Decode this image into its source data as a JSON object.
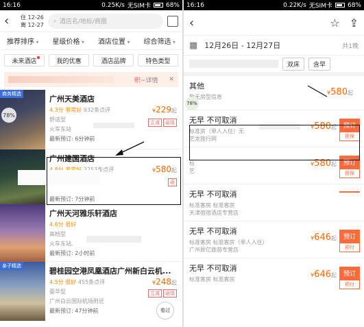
{
  "left": {
    "status": {
      "time": "16:16",
      "speed": "0.25K/s",
      "sim": "无SIM卡",
      "battery": "68%"
    },
    "dates": {
      "checkin": "住 12-26",
      "checkout": "离 12-27"
    },
    "search_placeholder": "酒店名/地标/商圈",
    "filters": [
      "推荐排序",
      "星级价格",
      "酒店位置",
      "综合筛选"
    ],
    "tags": [
      "未来酒店",
      "我的优惠",
      "酒店品牌",
      "特色类型"
    ],
    "promo": {
      "text": "积~",
      "detail": "详情",
      "close": "✕"
    },
    "hotels": [
      {
        "badge": "商务精选",
        "circle": "78%",
        "name": "广州天美酒店",
        "score": "4.3分",
        "level": "非常好",
        "reviews": "932条点评",
        "type": "舒适型",
        "loc": "火车东站",
        "recent": "最新预订: 6分钟前",
        "price": "229",
        "pills": [
          "立减",
          "返现"
        ]
      },
      {
        "name": "广州建国酒店",
        "score": "4.8分",
        "level": "非常好",
        "reviews": "2253条点评",
        "recent": "最新预订: 7分钟前",
        "price": "580",
        "pills": [
          "返"
        ]
      },
      {
        "name": "广州天河雅乐轩酒店",
        "score": "4.6分",
        "level": "很好",
        "type": "高档型",
        "loc": "火车东站,",
        "recent": "最新预订: 2小时前"
      },
      {
        "badge": "亲子精选",
        "name": "碧桂园空港凤凰酒店广州新白云机...",
        "score": "4.5分",
        "level": "很好",
        "reviews": "455条点评",
        "type": "豪华型",
        "loc": "广州白云国际机场附近",
        "recent": "最新预订: 47分钟前",
        "price": "248",
        "pills": [
          "立减",
          "返现"
        ],
        "kanguo": "看过"
      }
    ]
  },
  "right": {
    "status": {
      "time": "16:16",
      "speed": "0.22K/s",
      "sim": "无SIM卡",
      "battery": "68%"
    },
    "date_range": "12月26日 - 12月27日",
    "nights": "共1晚",
    "filter_tags": [
      "双床",
      "含早"
    ],
    "rooms": [
      {
        "title": "其他",
        "sub1": "暂无房型信息",
        "sub2": "",
        "price": "580",
        "circle": "78%"
      },
      {
        "title": "无早 不可取消",
        "sub1": "标准房（单人入住）无",
        "sub2": "艺龙旅行网",
        "price": "580",
        "book": "预订",
        "guarantee": "担保"
      },
      {
        "title": "",
        "sub1": "标",
        "sub2": "艺",
        "price": "580",
        "book": "预订",
        "guarantee": "担保"
      },
      {
        "title": "无早 不可取消",
        "sub1": "标准客房 标准客房",
        "sub2": "天津宿宿酒店专营店",
        "price": "",
        "book": "",
        "guarantee": ""
      },
      {
        "title": "无早 不可取消",
        "sub1": "标准客房 标准客房（单人入住）",
        "sub2": "广州辰亿旅游专营店",
        "price": "646",
        "book": "预订",
        "guarantee": "预付"
      },
      {
        "title": "无早 不可取消",
        "sub1": "标准客房 标准客房",
        "sub2": "",
        "price": "646",
        "book": "预订",
        "guarantee": "预付"
      }
    ]
  },
  "colors": {
    "accent": "#ff6600",
    "button": "#ff6a3d",
    "badge_blue": "#3a6dd8"
  },
  "icons": [
    "back-icon",
    "map-icon",
    "search-icon",
    "star-icon",
    "share-icon",
    "calendar-icon",
    "close-icon",
    "arrow-annotation"
  ]
}
